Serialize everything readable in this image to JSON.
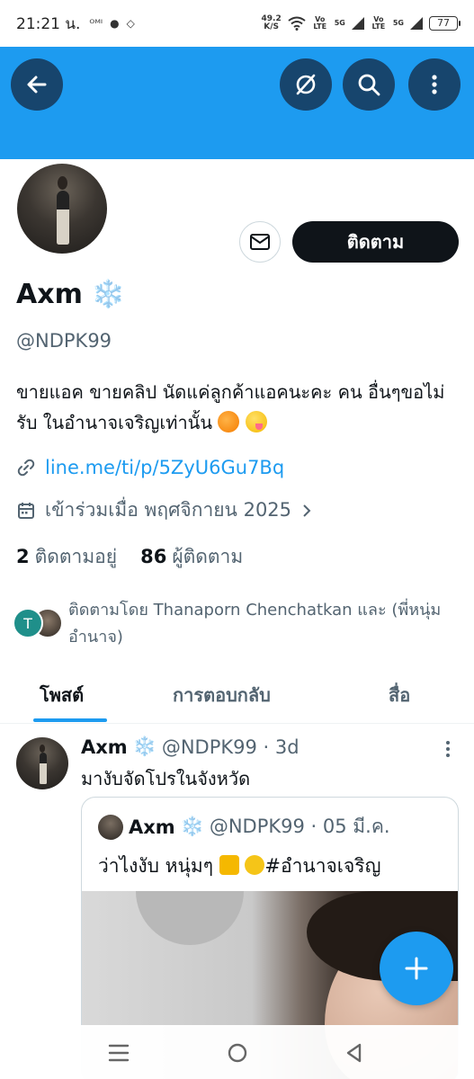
{
  "status_bar": {
    "time": "21:21 น.",
    "speed_value": "49.2",
    "speed_unit": "K/S",
    "network_1": "Vo LTE",
    "network_2": "5G",
    "network_3": "Vo LTE",
    "network_4": "5G",
    "battery": "77"
  },
  "header": {
    "back_icon": "arrow-left-icon",
    "incognito_icon": "no-sign-icon",
    "search_icon": "search-icon",
    "more_icon": "more-vertical-icon",
    "banner_color": "#1d9bf0"
  },
  "profile": {
    "follow_label": "ติดตาม",
    "message_icon": "mail-icon",
    "name": "Axm",
    "name_emoji": "❄️",
    "handle": "@NDPK99",
    "bio_text": "ขายแอค ขายคลิป นัดแค่ลูกค้าแอคนะคะ คน อื่นๆขอไม่รับ ในอำนาจเจริญเท่านั้น",
    "link": "line.me/ti/p/5ZyU6Gu7Bq",
    "joined": "เข้าร่วมเมื่อ พฤศจิกายน 2025",
    "following_count": "2",
    "following_label": "ติดตามอยู่",
    "followers_count": "86",
    "followers_label": "ผู้ติดตาม",
    "followed_by_initial": "T",
    "followed_by_text": "ติดตามโดย Thanaporn Chenchatkan และ (พี่หนุ่ม อำนาจ)"
  },
  "tabs": [
    {
      "label": "โพสต์",
      "active": true
    },
    {
      "label": "การตอบกลับ",
      "active": false
    },
    {
      "label": "สื่อ",
      "active": false
    }
  ],
  "post": {
    "name": "Axm",
    "emoji": "❄️",
    "handle_time": "@NDPK99 · 3d",
    "text": "มางับจัดโปรในจังหวัด",
    "quote": {
      "name": "Axm",
      "emoji": "❄️",
      "handle_time": "@NDPK99 · 05 มี.ค.",
      "text_start": "ว่าไงงับ หนุ่มๆ",
      "hashtag": "#อำนาจเจริญ"
    }
  },
  "fab_icon": "plus-icon",
  "nav": {
    "recents_icon": "menu-icon",
    "home_icon": "circle-home-icon",
    "back_icon": "triangle-back-icon"
  },
  "colors": {
    "accent": "#1d9bf0",
    "header_button": "#17456d",
    "text_primary": "#0f1419",
    "text_secondary": "#536471"
  }
}
